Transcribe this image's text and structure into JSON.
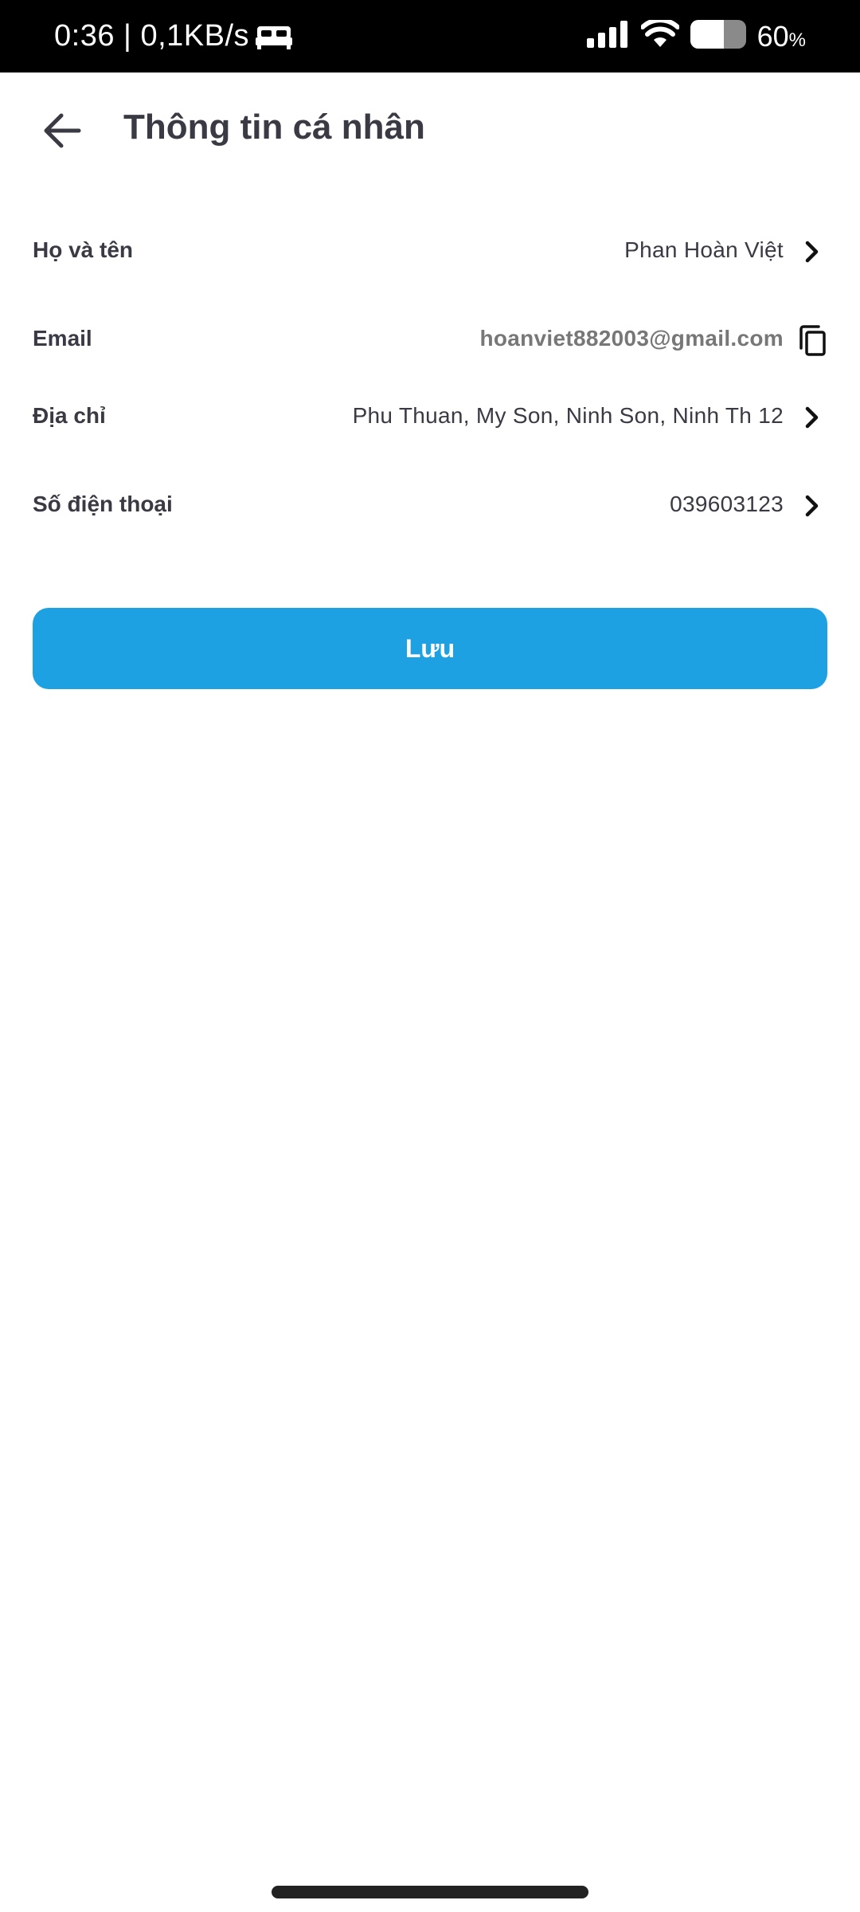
{
  "status_bar": {
    "time_speed": "0:36 | 0,1KB/s",
    "battery_percent": "60",
    "battery_unit": "%",
    "battery_level": 0.6,
    "icons": [
      "bed-icon",
      "signal-icon",
      "wifi-icon",
      "battery-icon"
    ]
  },
  "header": {
    "back_icon": "arrow-left-icon",
    "title": "Thông tin cá nhân"
  },
  "fields": [
    {
      "label": "Họ và tên",
      "value": "Phan Hoàn Việt",
      "action_icon": "chevron-right-icon"
    },
    {
      "label": "Email",
      "value": "hoanviet882003@gmail.com",
      "action_icon": "copy-icon"
    },
    {
      "label": "Địa chỉ",
      "value": "Phu Thuan, My Son, Ninh Son, Ninh Th 12",
      "action_icon": "chevron-right-icon"
    },
    {
      "label": "Số điện thoại",
      "value": "039603123",
      "action_icon": "chevron-right-icon"
    }
  ],
  "save_button": {
    "label": "Lưu",
    "color": "#1ea1e2"
  }
}
